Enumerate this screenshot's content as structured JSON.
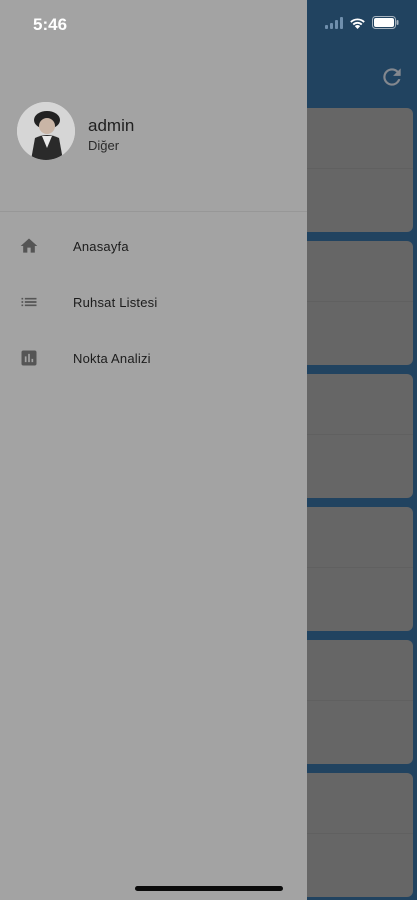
{
  "status_bar": {
    "time": "5:46",
    "icons": [
      "signal-icon",
      "wifi-icon",
      "battery-icon"
    ]
  },
  "background_app": {
    "header_color": "#1d5a8e",
    "refresh_icon": "refresh-icon",
    "card_count": 6
  },
  "drawer": {
    "user": {
      "name": "admin",
      "role": "Diğer",
      "avatar_icon": "avatar-photo"
    },
    "menu": [
      {
        "label": "Anasayfa",
        "icon": "home-icon"
      },
      {
        "label": "Ruhsat Listesi",
        "icon": "list-icon"
      },
      {
        "label": "Nokta Analizi",
        "icon": "bar-chart-icon"
      }
    ]
  },
  "colors": {
    "primary": "#1d5a8e",
    "drawer_bg": "#a3a3a3",
    "icon": "#555555"
  }
}
